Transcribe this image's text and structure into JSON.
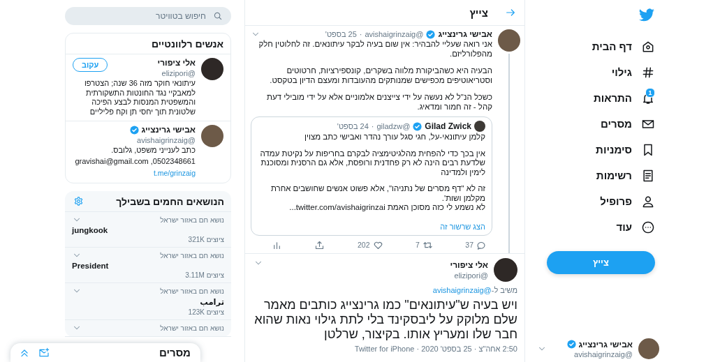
{
  "nav": {
    "items": [
      {
        "kind": "home",
        "label": "דף הבית"
      },
      {
        "kind": "explore",
        "label": "גילוי"
      },
      {
        "kind": "notifications",
        "label": "התראות",
        "badge": "1"
      },
      {
        "kind": "messages",
        "label": "מסרים"
      },
      {
        "kind": "bookmarks",
        "label": "סימניות"
      },
      {
        "kind": "lists",
        "label": "רשימות"
      },
      {
        "kind": "profile",
        "label": "פרופיל"
      },
      {
        "kind": "more",
        "label": "עוד"
      }
    ],
    "tweet_button": "צייץ",
    "account": {
      "name": "אבישי גרינצייג",
      "verified": true,
      "handle": "@avishaigrinzaig"
    }
  },
  "main": {
    "header": {
      "title": "צייץ"
    },
    "parent_tweet": {
      "name": "אבישי גרינצייג",
      "verified": true,
      "handle": "@avishaigrinzaig",
      "separator": "·",
      "date": "25 בספט'",
      "paragraphs": [
        "אני רואה שעליי להבהיר: אין שום בעיה לבקר עיתונאים. זה לחלוטין חלק מהפלורליזם.",
        "הבעיה היא כשהביקורת מלווה בשקרים, קונספירציות, חרטוטים וסטריאוטיפים מכפישים שמנותקים מהעובדות ומעצם הדיון בטקסט.",
        "כשכל הנ\"ל לא נעשה על ידי צייצנים אלמוניים אלא על ידי מובילי דעת קהל - זה חמור ומדאיג."
      ],
      "quote": {
        "name": "Gilad Zwick",
        "verified": true,
        "handle": "@giladzw",
        "separator": "·",
        "date": "24 בספט'",
        "paragraphs": [
          "קלמן עיתונאי-על, חגי סגל עורך נהדר ואבישי כתב מצוין",
          "אין בכך כדי להפחית מהלגיטימציה לבקרם בחריפות על נקיטת עמדה שלדעת רבים הינה לא רק פחדנית ורופסת, אלא גם הרסנית ומסוכנת לימין ולמדינה",
          "זה לא \"דף מסרים של נתניהו\", אלא פשוט אנשים שחושבים אחרת מקלמן ושות'.\nלא נשמע לי כזה מסוכן האמת twitter.com/avishaigrinzai..."
        ],
        "show_thread": "הצג שרשור זה"
      },
      "actions": {
        "replies": "37",
        "retweets": "7",
        "likes": "202"
      }
    },
    "focal_tweet": {
      "name": "אלי ציפורי",
      "handle": "@elizipori",
      "reply_label": "משיב ל-",
      "reply_to": "@avishaigrinzaig",
      "text": "ויש בעיה ש\"עיתונאים\" כמו גרינצייג כותבים מאמר שלם מלוקק על ליבסקינד בלי לתת גילוי נאות שהוא חבר שלו ומעריץ אותו. בקיצור, שרלטן",
      "footer": "2:50 אחה\"צ · 25 בספט' 2020 · Twitter for iPhone"
    }
  },
  "sidebar": {
    "search": {
      "placeholder": "חיפוש בטוויטר"
    },
    "who_to_follow": {
      "title": "אנשים רלוונטיים",
      "people": [
        {
          "name": "אלי ציפורי",
          "handle": "@elizipori",
          "follow_button": "עקוב",
          "bio": [
            "עיתונאי חוקר מזה 36 שנה; הצטרפו למאבקיי נגד החונטות התשקורתית והמשפטית המנסות לבצע הפיכה שלטונית תוך יחסי תן וקח פליליים"
          ]
        },
        {
          "name": "אבישי גרינצייג",
          "verified": true,
          "handle": "@avishaigrinzaig",
          "bio": [
            "כתב לענייני משפט, גלובס.",
            "0502348661, gravishai@gmail.com"
          ],
          "link": "t.me/grinzaig"
        }
      ]
    },
    "trends": {
      "title": "הנושאים החמים בשבילך",
      "items": [
        {
          "context": "נושא חם באזור ישראל",
          "name": "jungkook",
          "count": "ציוצים 321K"
        },
        {
          "context": "נושא חם באזור ישראל",
          "name": "President",
          "count": "ציוצים 3.11M"
        },
        {
          "context": "נושא חם באזור ישראל",
          "name": "ترامب",
          "count": "ציוצים 123K"
        },
        {
          "context": "נושא חם באזור ישראל"
        }
      ]
    }
  },
  "messages_drawer": {
    "title": "מסרים"
  }
}
